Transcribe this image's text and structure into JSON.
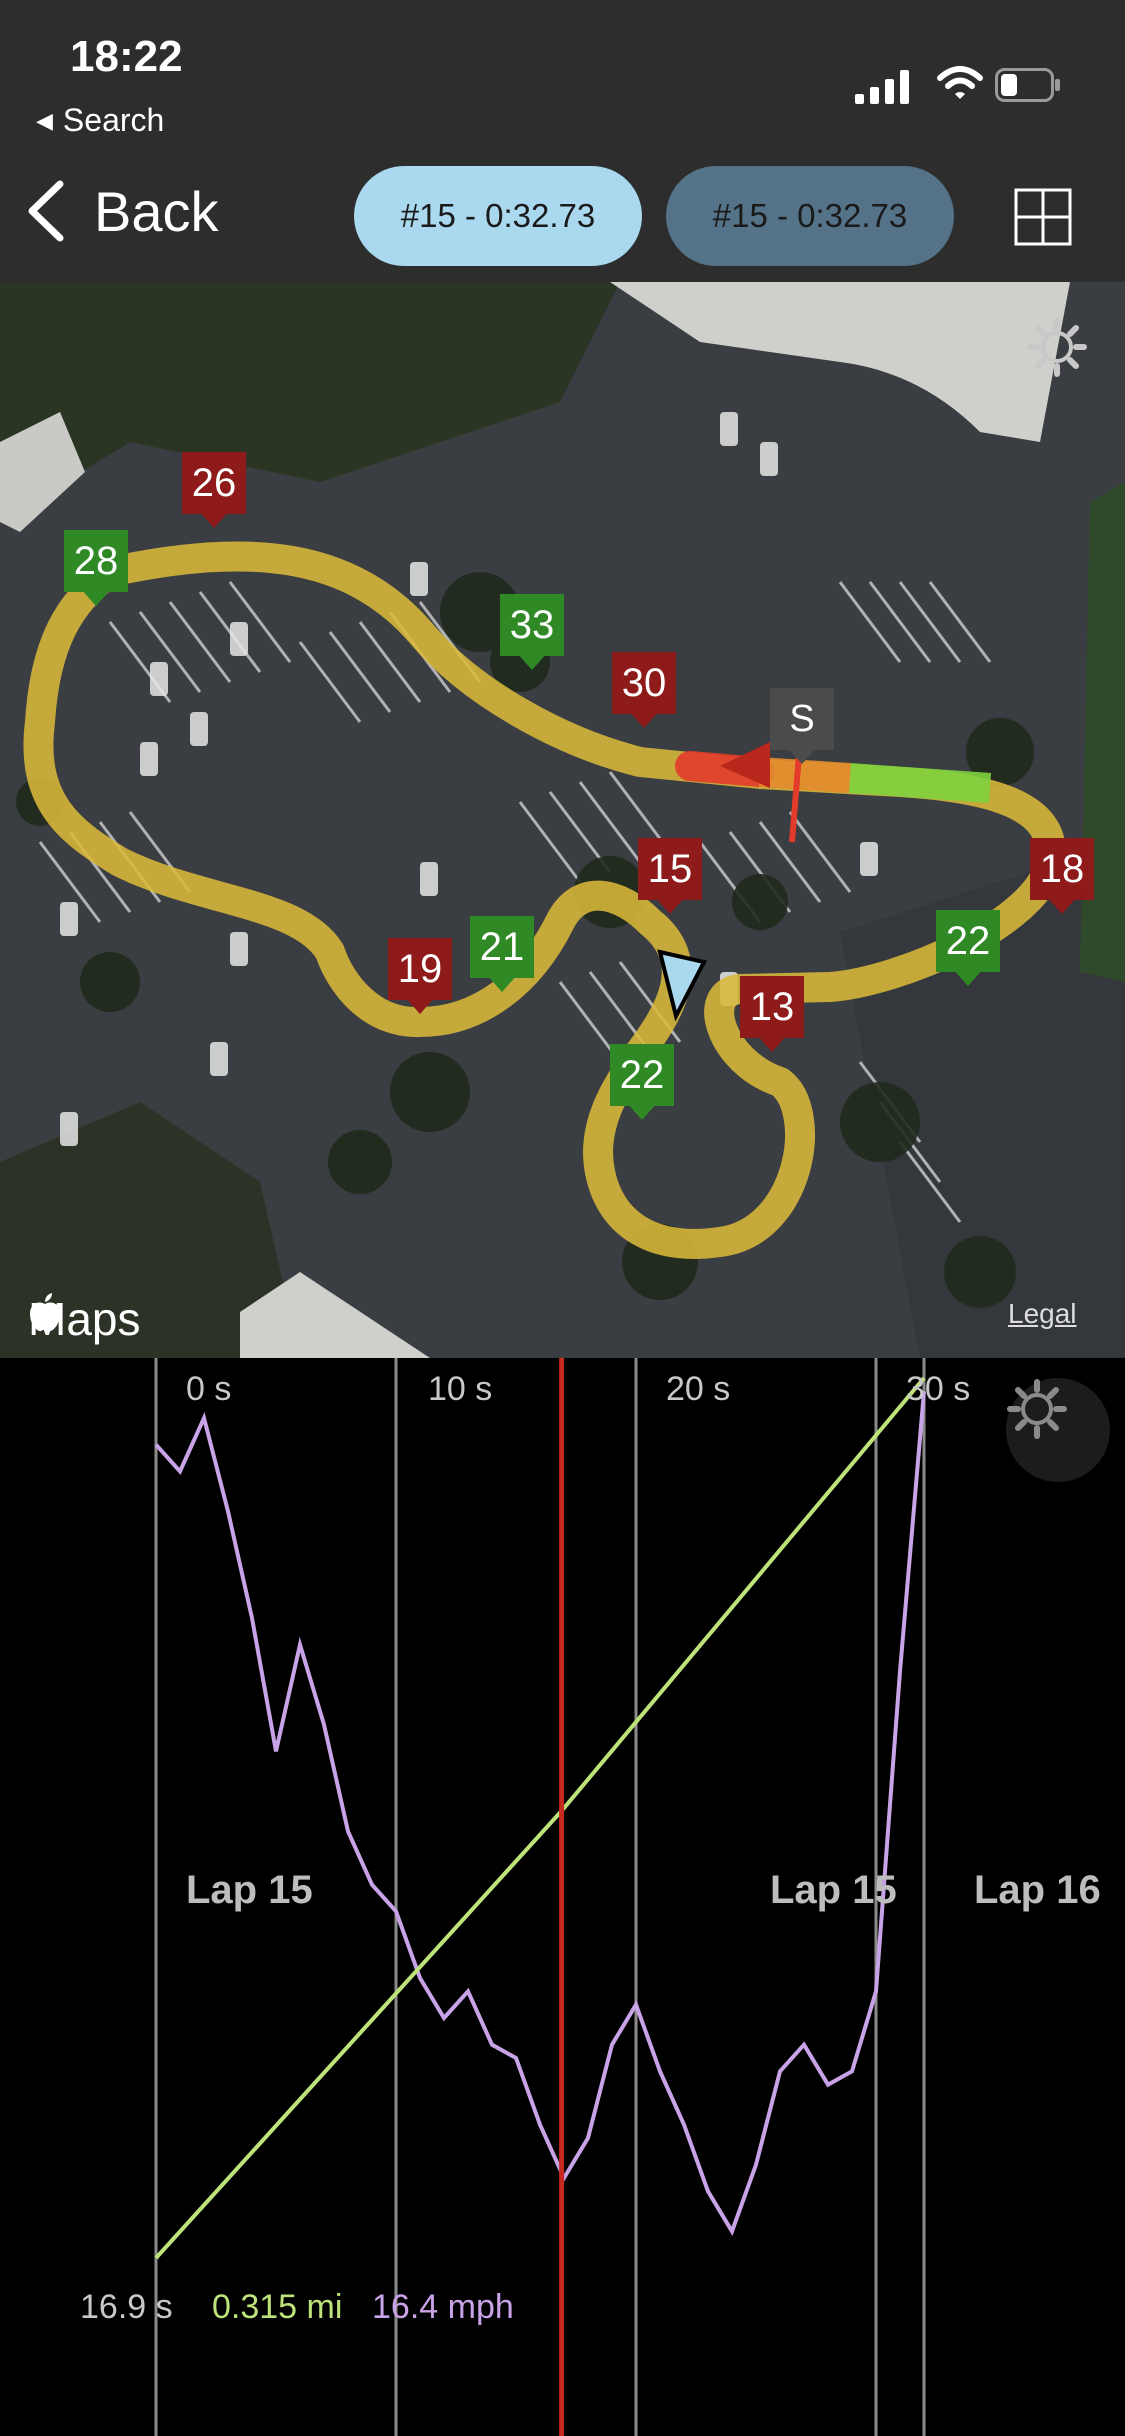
{
  "status_bar": {
    "time": "18:22",
    "back_app": "Search"
  },
  "nav": {
    "back_label": "Back",
    "lap_selector_1": "#15 - 0:32.73",
    "lap_selector_2": "#15 - 0:32.73",
    "grid_icon": "grid-icon"
  },
  "map": {
    "brand": "Maps",
    "legal": "Legal",
    "markers": [
      {
        "label": "26",
        "color": "#8e1a1a"
      },
      {
        "label": "28",
        "color": "#2f8a25"
      },
      {
        "label": "33",
        "color": "#2f8a25"
      },
      {
        "label": "30",
        "color": "#8e1a1a"
      },
      {
        "label": "S",
        "color": "#4b4b4b"
      },
      {
        "label": "15",
        "color": "#8e1a1a"
      },
      {
        "label": "18",
        "color": "#8e1a1a"
      },
      {
        "label": "22",
        "color": "#2f8a25"
      },
      {
        "label": "21",
        "color": "#2f8a25"
      },
      {
        "label": "19",
        "color": "#8e1a1a"
      },
      {
        "label": "13",
        "color": "#8e1a1a"
      },
      {
        "label": "22",
        "color": "#2f8a25"
      }
    ]
  },
  "chart": {
    "x_ticks": [
      "0 s",
      "10 s",
      "20 s",
      "30 s"
    ],
    "laps": [
      "Lap 15",
      "Lap 15",
      "Lap 16"
    ],
    "readout": {
      "time": "16.9 s",
      "distance": "0.315 mi",
      "speed": "16.4 mph"
    },
    "colors": {
      "speed": "#c9a3e8",
      "distance": "#bde37a",
      "cursor": "#c42a1e",
      "gridline": "#8c8c8c"
    }
  },
  "chart_data": {
    "type": "line",
    "x_ticks": [
      "0 s",
      "10 s",
      "20 s",
      "30 s"
    ],
    "cursor_x": 16.9,
    "series": [
      {
        "x": [
          0,
          1,
          2,
          3,
          4,
          5,
          6,
          7,
          8,
          9,
          10,
          11,
          12,
          13,
          14,
          15,
          16,
          17,
          18,
          19,
          20,
          21,
          22,
          23,
          24,
          25,
          26,
          27,
          28,
          29,
          30,
          31,
          32
        ],
        "values": [
          30.5,
          29.5,
          31.5,
          28,
          24,
          19,
          23,
          20,
          16,
          14,
          13,
          10.5,
          9,
          10,
          8,
          7.5,
          5,
          3,
          4.5,
          8,
          9.5,
          7,
          5,
          2.5,
          1,
          3.5,
          7,
          8,
          6.5,
          7,
          10,
          22,
          32.5
        ]
      },
      {
        "x": [
          0,
          16.9,
          32
        ],
        "values": [
          0,
          0.315,
          0.62
        ]
      }
    ]
  }
}
